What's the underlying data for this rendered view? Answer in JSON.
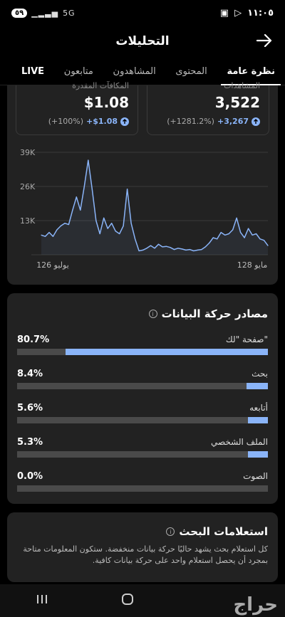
{
  "status": {
    "time": "١١:٠٥",
    "battery": "٥٩",
    "network": "5G"
  },
  "header": {
    "title": "التحليلات"
  },
  "tabs": [
    "نظرة عامة",
    "المحتوى",
    "المشاهدون",
    "متابعون",
    "LIVE"
  ],
  "stats": {
    "views": {
      "label": "المشاهدات",
      "value": "3,522",
      "delta": "+3,267",
      "percent": "(+1281.2%)"
    },
    "earnings": {
      "label": "المكافآت المقدرة",
      "value": "$1.08",
      "delta": "+$1.08",
      "percent": "(+100%)"
    }
  },
  "chart_data": {
    "type": "line",
    "x_labels": [
      "يوليو 126",
      "مايو 128"
    ],
    "y_ticks": [
      "39K",
      "26K",
      "13K"
    ],
    "ylim": [
      0,
      39000
    ],
    "grid": true,
    "values": [
      7500,
      7000,
      8500,
      7000,
      9500,
      11000,
      12000,
      11500,
      17000,
      22000,
      17000,
      26000,
      36000,
      25000,
      13000,
      8000,
      14000,
      10000,
      12000,
      9000,
      8000,
      11000,
      25000,
      12000,
      6000,
      1500,
      1800,
      2500,
      3500,
      2500,
      4000,
      3000,
      3200,
      2800,
      2000,
      2500,
      2200,
      1800,
      2000,
      1500,
      1800,
      2000,
      3000,
      4500,
      6500,
      6000,
      8500,
      7500,
      8000,
      9500,
      14000,
      8500,
      6500,
      10000,
      7500,
      8000,
      6000,
      5500,
      3500
    ]
  },
  "traffic": {
    "title": "مصادر حركة البيانات",
    "rows": [
      {
        "name": "صفحة \"لك\"",
        "percent": "80.7%",
        "value": 0.807
      },
      {
        "name": "بحث",
        "percent": "8.4%",
        "value": 0.084
      },
      {
        "name": "أتابعه",
        "percent": "5.6%",
        "value": 0.056
      },
      {
        "name": "الملف الشخصي",
        "percent": "5.3%",
        "value": 0.053
      },
      {
        "name": "الصوت",
        "percent": "0.0%",
        "value": 0.0
      }
    ]
  },
  "search": {
    "title": "استعلامات البحث",
    "description": "كل استعلام بحث يشهد حاليًا حركة بيانات منخفضة. ستكون المعلومات متاحة بمجرد أن يحصل استعلام واحد على حركة بيانات كافية."
  },
  "watermark": "حراج"
}
